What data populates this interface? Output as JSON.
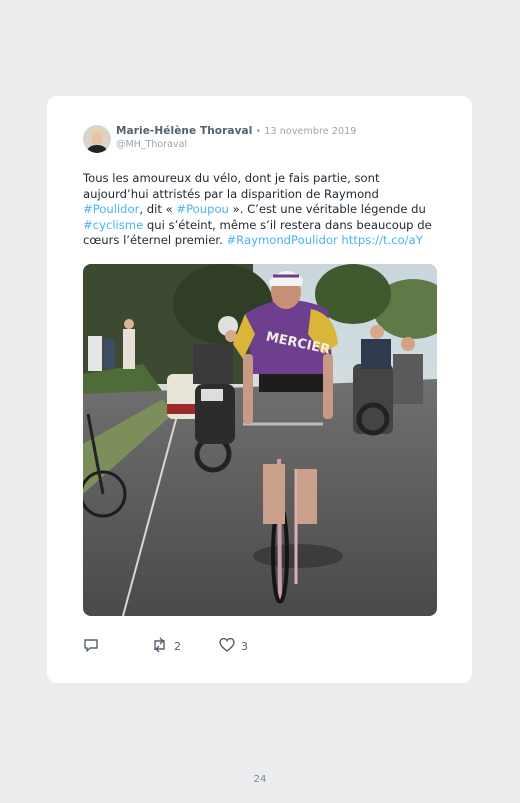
{
  "tweet": {
    "author_name": "Marie-Hélène Thoraval",
    "separator": " • ",
    "date": "13 novembre 2019",
    "handle": "@MH_Thoraval",
    "text_1": "Tous les amoureux du vélo, dont je fais partie, sont aujourd’hui attristés par la disparition de Raymond ",
    "hashtag_poulidor": "#Poulidor",
    "text_2": ", dit « ",
    "hashtag_poupou": "#Poupou",
    "text_3": " ». C’est une véritable légende du ",
    "hashtag_cyclisme": "#cyclisme",
    "text_4": " qui s’éteint, même s’il restera dans beaucoup de cœurs l’éternel premier. ",
    "hashtag_raymond": "#RaymondPoulidor",
    "text_5": " ",
    "url": "https://t.co/aY",
    "jersey_text": "MERCIER",
    "retweet_count": "2",
    "like_count": "3",
    "icons": [
      "reply-icon",
      "retweet-icon",
      "like-icon"
    ]
  },
  "page": {
    "number": "24"
  },
  "colors": {
    "link": "#4ab3f4",
    "background": "#ebedef",
    "card": "#ffffff"
  }
}
